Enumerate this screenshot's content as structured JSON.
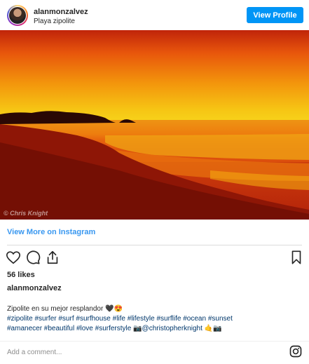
{
  "header": {
    "username": "alanmonzalvez",
    "location": "Playa zipolite",
    "view_profile_label": "View Profile"
  },
  "photo": {
    "watermark": "© Chris Knight"
  },
  "view_more_label": "View More on Instagram",
  "likes": "56 likes",
  "caption": {
    "username": "alanmonzalvez",
    "line1": "Zipolite en su mejor resplandor 🖤😍",
    "line2": "#zipolite #surfer #surf #surfhouse #life #lifestyle #surflife #ocean #sunset",
    "line3": "#amanecer #beautiful #love #surferstyle 📷@christopherknight 🤙📷"
  },
  "comment_placeholder": "Add a comment...",
  "colors": {
    "accent": "#0095f6",
    "link": "#3897f0",
    "hashtag": "#00376b"
  },
  "icons": [
    "heart-icon",
    "comment-icon",
    "share-icon",
    "bookmark-icon",
    "instagram-logo-icon"
  ]
}
